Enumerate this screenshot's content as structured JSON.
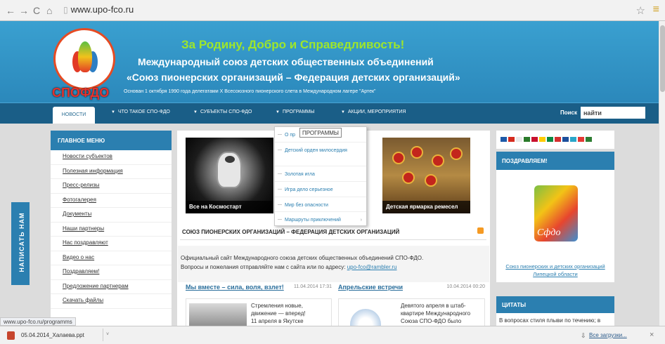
{
  "browser": {
    "url": "www.upo-fco.ru",
    "status_url": "www.upo-fco.ru/programms",
    "icons": [
      "back-icon",
      "forward-icon",
      "reload-icon",
      "home-icon",
      "page-icon",
      "star-icon",
      "menu-icon"
    ]
  },
  "header": {
    "logo_text": "СПОФДО",
    "slogan": "За Родину, Добро и Справедливость!",
    "title_line1": "Международный союз детских общественных объединений",
    "title_line2": "«Союз пионерских организаций – Федерация детских организаций»",
    "founded": "Основан 1 октября 1990 года делегатами X Всесоюзного пионерского слета в Международном лагере \"Артек\""
  },
  "nav": {
    "items": [
      "НОВОСТИ",
      "ЧТО ТАКОЕ СПО-ФДО",
      "СУБЪЕКТЫ СПО-ФДО",
      "ПРОГРАММЫ",
      "АКЦИИ, МЕРОПРИЯТИЯ"
    ],
    "search_label": "Поиск",
    "search_value": "найти"
  },
  "left_menu": {
    "title": "ГЛАВНОЕ МЕНЮ",
    "items": [
      "Новости субъектов",
      "Полезная информация",
      "Пресс-релизы",
      "Фотогалерея",
      "Документы",
      "Наши партнеры",
      "Нас поздравляют",
      "Видео о нас",
      "Поздравляем!",
      "Предложение партнерам",
      "Скачать файлы"
    ]
  },
  "feedback_tab": "НАПИСАТЬ НАМ",
  "slides": [
    "Все на Космостарт",
    "Детская ярмарка ремесел"
  ],
  "dropdown": {
    "tooltip": "ПРОГРАММЫ",
    "items": [
      "О пр",
      "Детский орден милосердия",
      "Золотая игла",
      "Игра дело серьезное",
      "Мир без опасности",
      "Маршруты приключений"
    ],
    "submenu_glyph": "›"
  },
  "section": {
    "title": "СОЮЗ ПИОНЕРСКИХ ОРГАНИЗАЦИЙ – ФЕДЕРАЦИЯ ДЕТСКИХ ОРГАНИЗАЦИЙ",
    "intro_line1": "Официальный сайт Международного союза детских общественных объединений СПО-ФДО.",
    "intro_line2": "Вопросы и пожелания отправляйте нам с сайта или по адресу:",
    "email": "upo-fco@rambler.ru"
  },
  "news": [
    {
      "title": "Мы вместе – сила, воля, взлет!",
      "date": "11.04.2014 17:31",
      "text": [
        "Стремления новые,",
        "движение — вперед!",
        "11 апреля в Якутске"
      ]
    },
    {
      "title": "Апрельские встречи",
      "date": "10.04.2014 00:20",
      "text": [
        "Девятого апреля в штаб-",
        "квартире Международного",
        "Союза СПО-ФДО было"
      ]
    }
  ],
  "right": {
    "congrats_title": "ПОЗДРАВЛЯЕМ!",
    "emblem_text": "Сфдо",
    "congrats_link_line1": "Союз пионерских и детских организаций",
    "congrats_link_line2": "Липецкой области",
    "quotes_title": "ЦИТАТЫ",
    "quote_text": "В вопросах стиля плыви по течению; в",
    "flag_colors": [
      "#1e5aa8",
      "#d52b1e",
      "#e9e9e9",
      "#2a7a2a",
      "#c8102e",
      "#ffcc00",
      "#0b8a43",
      "#d32f2f",
      "#1c4f9c",
      "#2aa6c9",
      "#e53935",
      "#2e7d32"
    ]
  },
  "downloads": {
    "file": "05.04.2014_Халаева.ppt",
    "caret": "˅",
    "all_label": "Все загрузки...",
    "close": "×"
  }
}
